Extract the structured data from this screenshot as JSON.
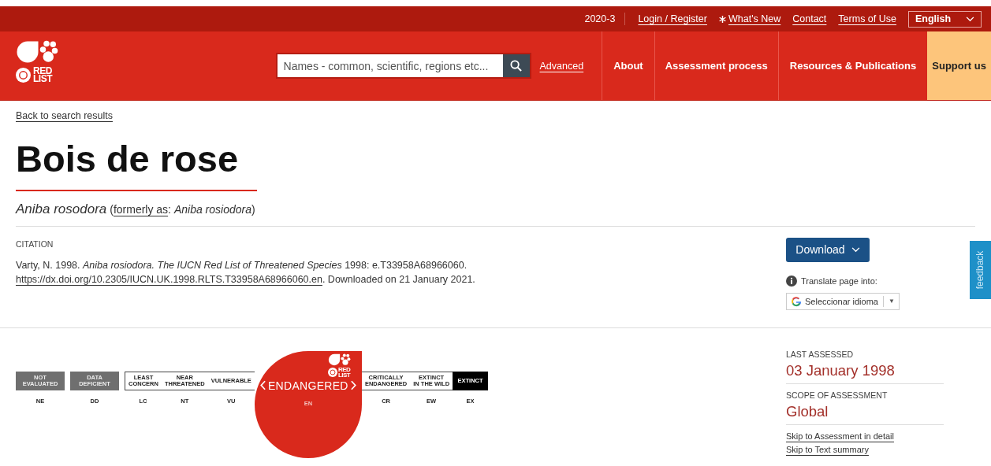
{
  "top_bar": {
    "version": "2020-3",
    "links": [
      {
        "label": "Login / Register",
        "kind": "plain"
      },
      {
        "label": "What's New",
        "kind": "starred"
      },
      {
        "label": "Contact",
        "kind": "plain"
      },
      {
        "label": "Terms of Use",
        "kind": "plain"
      }
    ],
    "language": "English"
  },
  "header": {
    "logo": {
      "lines": [
        "RED",
        "LIST"
      ]
    },
    "search": {
      "placeholder": "Names - common, scientific, regions etc..."
    },
    "advanced": "Advanced",
    "nav": [
      {
        "label": "About",
        "kind": "plain"
      },
      {
        "label": "Assessment process",
        "kind": "plain"
      },
      {
        "label": "Resources & Publications",
        "kind": "plain"
      },
      {
        "label": "Support us",
        "kind": "highlight"
      }
    ]
  },
  "back_link": "Back to search results",
  "title": "Bois de rose",
  "scientific_name": {
    "name": "Aniba rosodora",
    "open": "(",
    "link": "formerly as",
    "after": ": *Aniba rosiodora*)"
  },
  "citation": {
    "heading": "CITATION",
    "before": "Varty, N. 1998. *Aniba rosiodora. The IUCN Red List of Threatened Species* 1998: e.T33958A68966060.",
    "link": "https://dx.doi.org/10.2305/IUCN.UK.1998.RLTS.T33958A68966060.en",
    "after": ". Downloaded on 21 January 2021."
  },
  "download": "Download",
  "translate": {
    "label": "Translate page into:",
    "select": "Seleccionar idioma",
    "arrow": "▼"
  },
  "feedback": "feedback",
  "scale": {
    "logo": {
      "lines": [
        "RED",
        "LIST"
      ]
    },
    "categories": [
      {
        "label": "NOT\nEVALUATED",
        "code": "NE",
        "kind": "muted",
        "selected": false
      },
      {
        "label": "DATA\nDEFICIENT",
        "code": "DD",
        "kind": "muted",
        "selected": false
      },
      {
        "label": "LEAST\nCONCERN",
        "code": "LC",
        "kind": "outlined",
        "selected": false
      },
      {
        "label": "NEAR\nTHREATENED",
        "code": "NT",
        "kind": "outlined",
        "selected": false
      },
      {
        "label": "VULNERABLE",
        "code": "VU",
        "kind": "outlined",
        "selected": false
      },
      {
        "label": "ENDANGERED",
        "code": "EN",
        "selected": true
      },
      {
        "label": "CRITICALLY\nENDANGERED",
        "code": "CR",
        "kind": "outlined",
        "selected": false
      },
      {
        "label": "EXTINCT\nIN THE WILD",
        "code": "EW",
        "kind": "outlined",
        "selected": false
      },
      {
        "label": "EXTINCT",
        "code": "EX",
        "kind": "solid",
        "selected": false
      }
    ]
  },
  "assessment": [
    {
      "label": "LAST ASSESSED",
      "value": "03 January 1998"
    },
    {
      "label": "SCOPE OF ASSESSMENT",
      "value": "Global"
    }
  ],
  "skip_links": [
    "Skip to Assessment in detail",
    "Skip to Text summary"
  ]
}
